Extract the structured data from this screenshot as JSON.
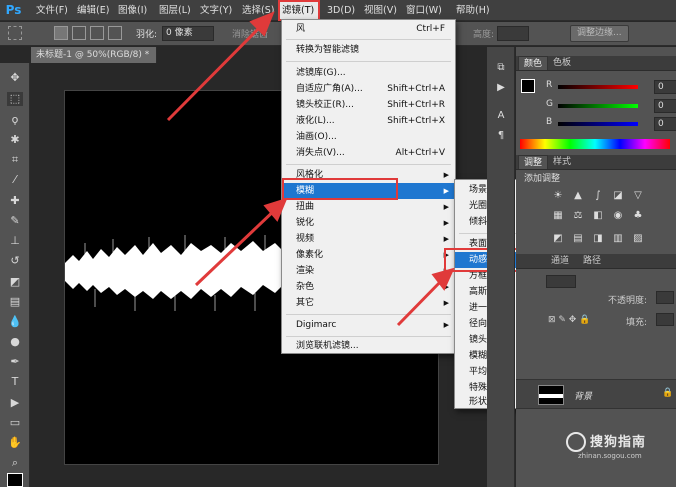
{
  "app": {
    "logo": "Ps"
  },
  "menubar": {
    "items": [
      "文件(F)",
      "编辑(E)",
      "图像(I)",
      "图层(L)",
      "文字(Y)",
      "选择(S)",
      "滤镜(T)",
      "3D(D)",
      "视图(V)",
      "窗口(W)",
      "帮助(H)"
    ],
    "active": "滤镜(T)"
  },
  "options": {
    "feather_label": "羽化:",
    "feather_value": "0 像素",
    "antialias_label": "消除锯齿",
    "height_label": "高度:",
    "refine_button": "调整边缘..."
  },
  "document": {
    "tab_title": "未标题-1 @ 50%(RGB/8) *"
  },
  "filter_menu": {
    "items": [
      {
        "label": "风",
        "shortcut": "Ctrl+F"
      },
      {
        "label": "转换为智能滤镜"
      },
      {
        "label": "滤镜库(G)..."
      },
      {
        "label": "自适应广角(A)...",
        "shortcut": "Shift+Ctrl+A"
      },
      {
        "label": "镜头校正(R)...",
        "shortcut": "Shift+Ctrl+R"
      },
      {
        "label": "液化(L)...",
        "shortcut": "Shift+Ctrl+X"
      },
      {
        "label": "油画(O)..."
      },
      {
        "label": "消失点(V)...",
        "shortcut": "Alt+Ctrl+V"
      },
      {
        "label": "风格化"
      },
      {
        "label": "模糊"
      },
      {
        "label": "扭曲"
      },
      {
        "label": "锐化"
      },
      {
        "label": "视频"
      },
      {
        "label": "像素化"
      },
      {
        "label": "渲染"
      },
      {
        "label": "杂色"
      },
      {
        "label": "其它"
      },
      {
        "label": "Digimarc"
      },
      {
        "label": "浏览联机滤镜..."
      }
    ],
    "highlighted": "模糊"
  },
  "blur_submenu": {
    "items": [
      "场景模糊...",
      "光圈模糊...",
      "倾斜偏移...",
      "表面模糊...",
      "动感模糊...",
      "方框模糊...",
      "高斯模糊...",
      "进一步模糊",
      "径向模糊...",
      "镜头模糊...",
      "模糊",
      "平均",
      "特殊模糊...",
      "形状模糊..."
    ],
    "highlighted": "动感模糊..."
  },
  "panels": {
    "color_tabs": [
      "颜色",
      "色板"
    ],
    "channels": [
      {
        "label": "R",
        "value": "0"
      },
      {
        "label": "G",
        "value": "0"
      },
      {
        "label": "B",
        "value": "0"
      }
    ],
    "adjust_tabs": [
      "调整",
      "样式"
    ],
    "adjust_title": "添加调整",
    "layers_tabs": [
      "通道",
      "路径"
    ],
    "opacity_label": "不透明度:",
    "fill_label": "填充:",
    "layer_name": "背景"
  },
  "watermark": {
    "title": "搜狗指南",
    "url": "zhinan.sogou.com"
  },
  "colors": {
    "highlight": "#1f77d0",
    "annotation": "#e03a3a",
    "accent": "#31a8ff"
  }
}
